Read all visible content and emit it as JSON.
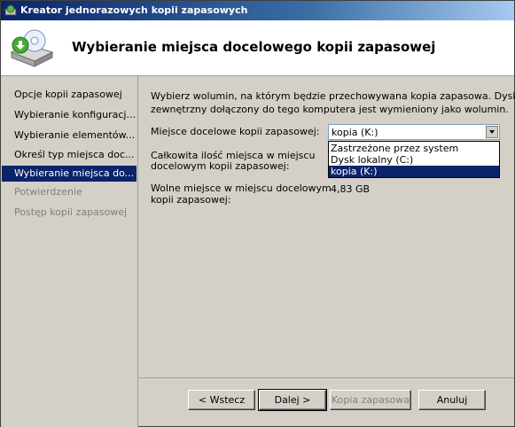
{
  "window": {
    "title": "Kreator jednorazowych kopii zapasowych"
  },
  "header": {
    "heading": "Wybieranie miejsca docelowego kopii zapasowej",
    "icon": "backup-disk-icon"
  },
  "sidebar": {
    "items": [
      {
        "label": "Opcje kopii zapasowej",
        "state": "normal"
      },
      {
        "label": "Wybieranie konfiguracj...",
        "state": "normal"
      },
      {
        "label": "Wybieranie elementów...",
        "state": "normal"
      },
      {
        "label": "Określ typ miejsca doc...",
        "state": "normal"
      },
      {
        "label": "Wybieranie miejsca do...",
        "state": "selected"
      },
      {
        "label": "Potwierdzenie",
        "state": "disabled"
      },
      {
        "label": "Postęp kopii zapasowej",
        "state": "disabled"
      }
    ]
  },
  "main": {
    "intro_line1": "Wybierz wolumin, na którym będzie przechowywana kopia zapasowa. Dysk",
    "intro_line2": "zewnętrzny dołączony do tego komputera jest wymieniony jako wolumin.",
    "dest_label": "Miejsce docelowe kopii zapasowej:",
    "dest_value": "kopia (K:)",
    "dest_options": [
      "Zastrzeżone przez system",
      "Dysk lokalny (C:)",
      "kopia (K:)"
    ],
    "dest_selected_index": 2,
    "total_label_line1": "Całkowita ilość miejsca w miejscu",
    "total_label_line2": "docelowym kopii zapasowej:",
    "free_label_line1": "Wolne miejsce w miejscu docelowym",
    "free_label_line2": "kopii zapasowej:",
    "free_value": "4,83 GB"
  },
  "buttons": {
    "back": "< Wstecz",
    "next": "Dalej >",
    "backup": "Kopia zapasowa",
    "cancel": "Anuluj"
  },
  "colors": {
    "selection": "#0a246a",
    "dialog_bg": "#d4d0c8"
  }
}
